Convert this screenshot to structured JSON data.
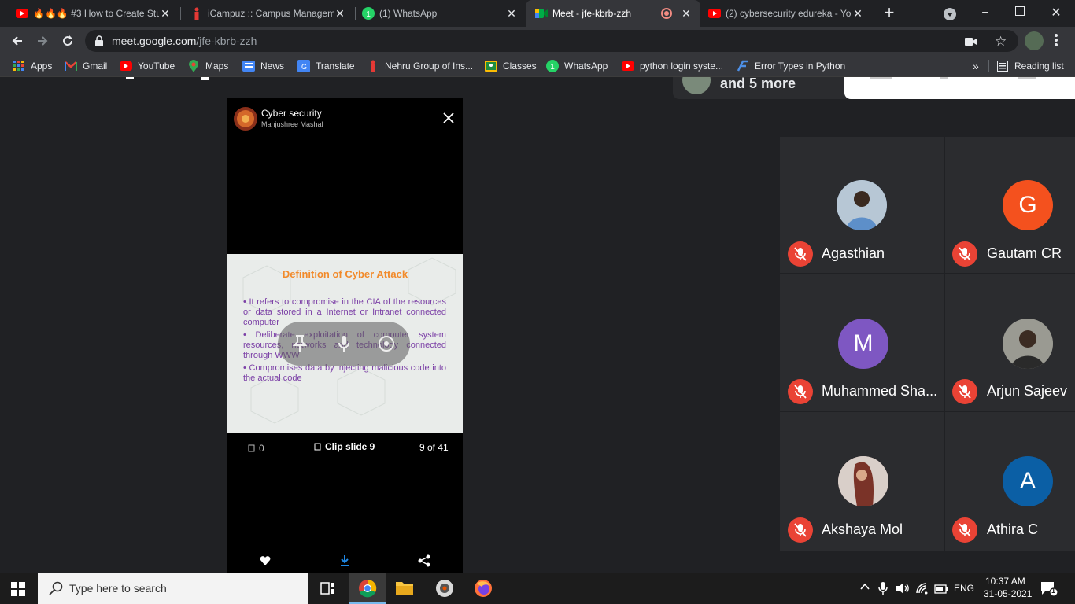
{
  "tabs": [
    {
      "title": "🔥🔥🔥 #3 How to Create Stu",
      "icon": "youtube-icon"
    },
    {
      "title": "iCampuz :: Campus Managem",
      "icon": "icampuz-icon"
    },
    {
      "title": "(1) WhatsApp",
      "icon": "whatsapp-icon"
    },
    {
      "title": "Meet - jfe-kbrb-zzh",
      "icon": "meet-icon",
      "active": true
    },
    {
      "title": "(2) cybersecurity edureka - Yo",
      "icon": "youtube-icon"
    }
  ],
  "address": {
    "host": "meet.google.com",
    "path": "/jfe-kbrb-zzh"
  },
  "bookmarks": [
    {
      "label": "Apps",
      "icon": "apps-grid-icon"
    },
    {
      "label": "Gmail",
      "icon": "gmail-icon"
    },
    {
      "label": "YouTube",
      "icon": "youtube-icon"
    },
    {
      "label": "Maps",
      "icon": "maps-icon"
    },
    {
      "label": "News",
      "icon": "news-icon"
    },
    {
      "label": "Translate",
      "icon": "translate-icon"
    },
    {
      "label": "Nehru Group of Ins...",
      "icon": "nehru-icon"
    },
    {
      "label": "Classes",
      "icon": "classroom-icon"
    },
    {
      "label": "WhatsApp",
      "icon": "whatsapp-icon"
    },
    {
      "label": "python login syste...",
      "icon": "youtube-icon"
    },
    {
      "label": "Error Types in Python",
      "icon": "error-types-icon"
    }
  ],
  "reading_list": "Reading list",
  "meet_header": {
    "more_text": "and 5 more"
  },
  "viewer": {
    "title": "Cyber security",
    "author": "Manjushree Mashal",
    "slide_title": "Definition of Cyber Attack",
    "bullets": [
      "It refers to compromise in the CIA of the resources or data stored in a Internet or Intranet connected computer",
      "Deliberate exploitation of computer system resources, networks and technology connected through WWW",
      "Compromises data by injecting malicious code into the actual code"
    ],
    "clip_count": "0",
    "clip_label": "Clip slide 9",
    "page_indicator": "9 of 41"
  },
  "participants": [
    {
      "name": "Agasthian",
      "avatar_letter": "",
      "color": "#4a6a8a"
    },
    {
      "name": "Gautam CR",
      "avatar_letter": "G",
      "color": "#f4511e"
    },
    {
      "name": "Muhammed Sha...",
      "avatar_letter": "M",
      "color": "#7e57c2"
    },
    {
      "name": "Arjun Sajeev",
      "avatar_letter": "",
      "color": "#5a5a5a"
    },
    {
      "name": "Akshaya Mol",
      "avatar_letter": "",
      "color": "#b89090"
    },
    {
      "name": "Athira C",
      "avatar_letter": "A",
      "color": "#0b5fa5"
    }
  ],
  "taskbar": {
    "search_placeholder": "Type here to search",
    "language": "ENG",
    "time": "10:37 AM",
    "date": "31-05-2021",
    "notifications": "1"
  },
  "colors": {
    "mute_red": "#ea4335",
    "meet_bg": "#202124",
    "slide_orange": "#f28a2a",
    "slide_purple": "#7b3fa6"
  }
}
